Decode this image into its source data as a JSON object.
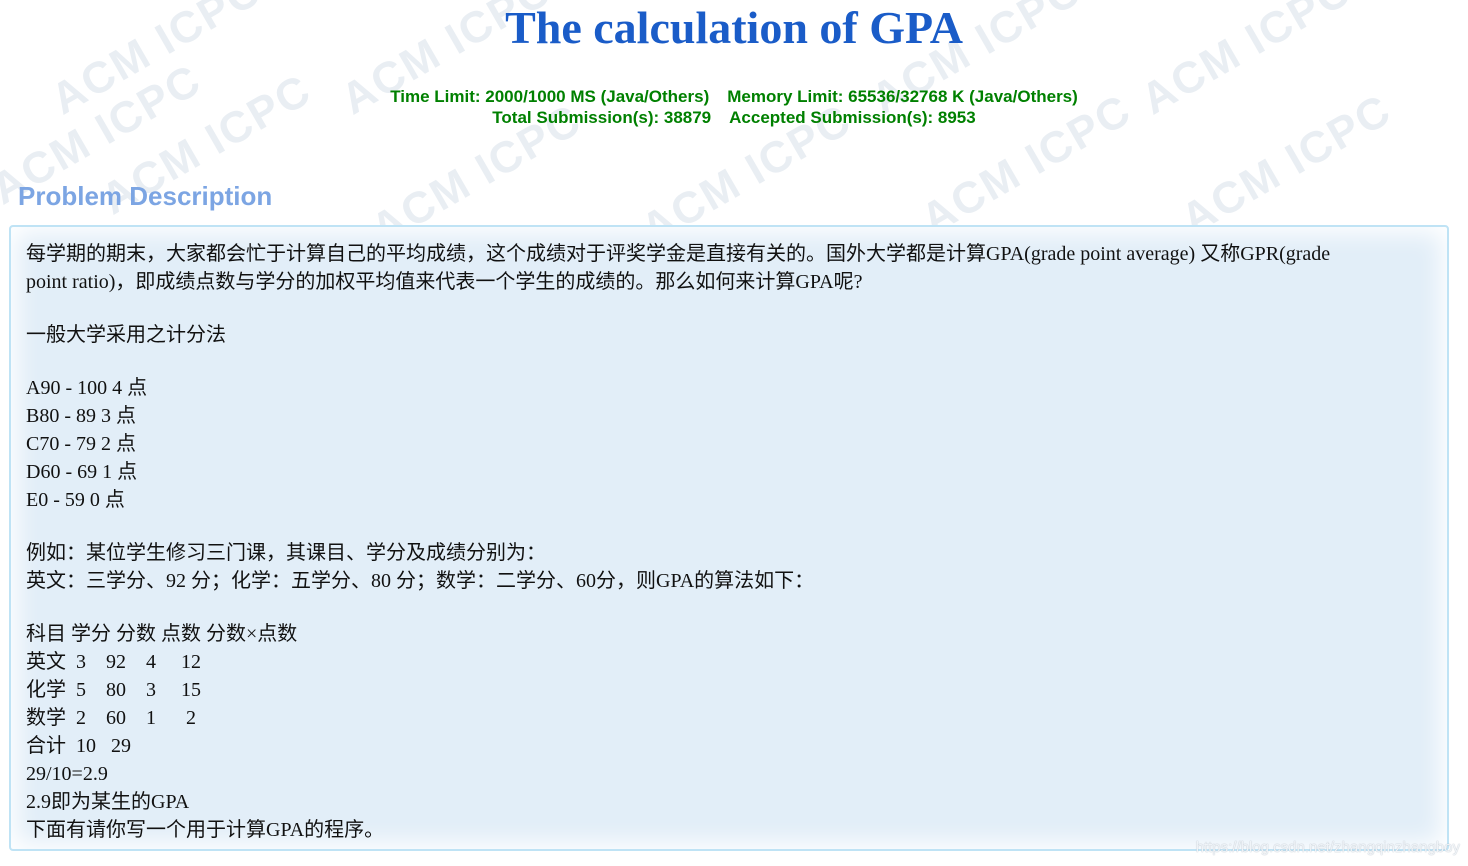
{
  "title": "The calculation of GPA",
  "limits": {
    "time_limit": "Time Limit: 2000/1000 MS (Java/Others)",
    "memory_limit": "Memory Limit: 65536/32768 K (Java/Others)",
    "total_submissions": "Total Submission(s): 38879",
    "accepted_submissions": "Accepted Submission(s): 8953"
  },
  "section_title": "Problem Description",
  "description": {
    "intro_line1": "每学期的期末，大家都会忙于计算自己的平均成绩，这个成绩对于评奖学金是直接有关的。国外大学都是计算GPA(grade point average) 又称GPR(grade",
    "intro_line2": "point ratio)，即成绩点数与学分的加权平均值来代表一个学生的成绩的。那么如何来计算GPA呢?",
    "method_heading": "一般大学采用之计分法",
    "grades": [
      "A90 - 100 4 点",
      "B80 - 89 3 点",
      "C70 - 79 2 点",
      "D60 - 69 1 点",
      "E0 - 59 0 点"
    ],
    "example_line1": "例如：某位学生修习三门课，其课目、学分及成绩分别为：",
    "example_line2": "英文：三学分、92 分；化学：五学分、80 分；数学：二学分、60分，则GPA的算法如下：",
    "table_header": "科目 学分 分数 点数 分数×点数",
    "table_rows": [
      "英文  3    92    4     12",
      "化学  5    80    3     15",
      "数学  2    60    1      2",
      "合计  10   29"
    ],
    "calc_line": "29/10=2.9",
    "result_line": "2.9即为某生的GPA",
    "task_line": "下面有请你写一个用于计算GPA的程序。"
  },
  "watermark_text": "ACM ICPC",
  "credit": "https://blog.csdn.net/zhangqinzhangboy"
}
